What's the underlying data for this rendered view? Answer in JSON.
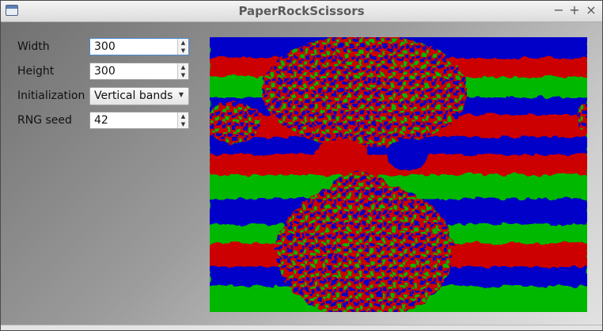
{
  "window": {
    "title": "PaperRockScissors",
    "controls": {
      "minimize": "−",
      "maximize": "+",
      "close": "×"
    }
  },
  "form": {
    "width": {
      "label": "Width",
      "value": "300"
    },
    "height": {
      "label": "Height",
      "value": "300"
    },
    "initialization": {
      "label": "Initialization",
      "value": "Vertical bands"
    },
    "rng_seed": {
      "label": "RNG seed",
      "value": "42"
    }
  },
  "simulation": {
    "grid_size": "300x300",
    "colors": {
      "red": "#cc0000",
      "green": "#00b800",
      "blue": "#0000c8"
    },
    "seed": 42
  },
  "icons": {
    "window": "app-window-icon",
    "spin_up": "chevron-up-icon",
    "spin_down": "chevron-down-icon",
    "dropdown": "dropdown-arrow-icon"
  }
}
